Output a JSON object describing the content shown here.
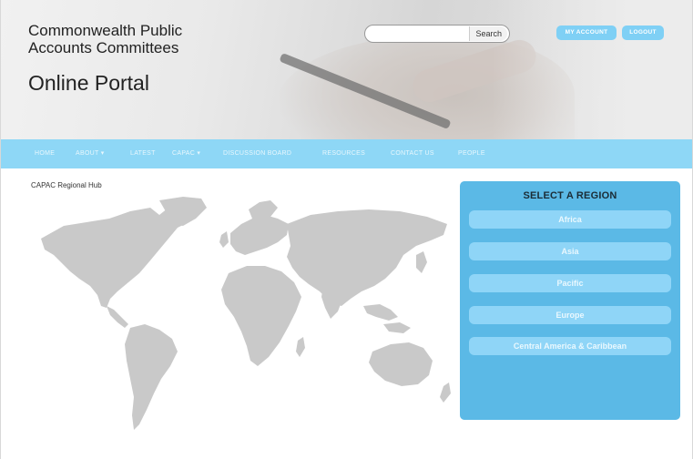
{
  "header": {
    "site_title": "Commonwealth Public Accounts Committees",
    "portal_title": "Online Portal",
    "search": {
      "placeholder": "",
      "button_label": "Search"
    },
    "account_button": "MY ACCOUNT",
    "logout_button": "LOGOUT"
  },
  "nav": {
    "items": [
      {
        "label": "HOME"
      },
      {
        "label": "ABOUT ▾"
      },
      {
        "label": "LATEST"
      },
      {
        "label": "CAPAC ▾"
      },
      {
        "label": "DISCUSSION BOARD"
      },
      {
        "label": "RESOURCES"
      },
      {
        "label": "CONTACT US"
      },
      {
        "label": "PEOPLE"
      }
    ]
  },
  "main": {
    "hub_label": "CAPAC Regional Hub"
  },
  "region_panel": {
    "title": "SELECT A REGION",
    "regions": [
      {
        "label": "Africa"
      },
      {
        "label": "Asia"
      },
      {
        "label": "Pacific"
      },
      {
        "label": "Europe"
      },
      {
        "label": "Central America & Caribbean"
      }
    ]
  },
  "colors": {
    "nav_bg": "#8ed7f6",
    "panel_bg": "#5bb9e6",
    "region_button_bg": "#8fd5f7",
    "header_button_bg": "#7fd0f5",
    "map_land": "#c9c9c9"
  }
}
